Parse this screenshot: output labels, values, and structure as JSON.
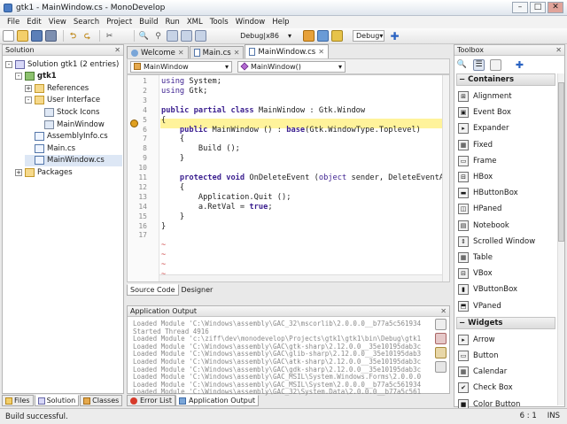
{
  "window": {
    "title": "gtk1 - MainWindow.cs - MonoDevelop"
  },
  "menu": [
    "File",
    "Edit",
    "View",
    "Search",
    "Project",
    "Build",
    "Run",
    "XML",
    "Tools",
    "Window",
    "Help"
  ],
  "toolbar": {
    "config": "Debug|x86",
    "build_target": "Debug"
  },
  "solution_panel": {
    "title": "Solution",
    "tree": [
      {
        "label": "Solution gtk1 (2 entries)",
        "indent": 0,
        "icon": "solution-icon",
        "expander": "-"
      },
      {
        "label": "gtk1",
        "indent": 1,
        "icon": "project-icon",
        "expander": "-",
        "bold": true
      },
      {
        "label": "References",
        "indent": 2,
        "icon": "folder-icon",
        "expander": "+"
      },
      {
        "label": "User Interface",
        "indent": 2,
        "icon": "folder-icon",
        "expander": "-"
      },
      {
        "label": "Stock Icons",
        "indent": 3,
        "icon": "stock-icons-icon",
        "expander": ""
      },
      {
        "label": "MainWindow",
        "indent": 3,
        "icon": "window-icon",
        "expander": ""
      },
      {
        "label": "AssemblyInfo.cs",
        "indent": 2,
        "icon": "cs-file-icon",
        "expander": ""
      },
      {
        "label": "Main.cs",
        "indent": 2,
        "icon": "cs-file-icon",
        "expander": ""
      },
      {
        "label": "MainWindow.cs",
        "indent": 2,
        "icon": "cs-file-icon",
        "expander": "",
        "selected": true
      },
      {
        "label": "Packages",
        "indent": 1,
        "icon": "folder-icon",
        "expander": "+"
      }
    ],
    "tabs": [
      "Files",
      "Solution",
      "Classes"
    ]
  },
  "editor": {
    "tabs": [
      "Welcome",
      "Main.cs",
      "MainWindow.cs"
    ],
    "active_tab": "MainWindow.cs",
    "class_combo": "MainWindow",
    "member_combo": "MainWindow()",
    "line_numbers": [
      "1",
      "2",
      "3",
      "4",
      "5",
      "6",
      "7",
      "8",
      "9",
      "10",
      "11",
      "12",
      "13",
      "14",
      "15",
      "16",
      "17"
    ],
    "view_tabs": [
      "Source Code",
      "Designer"
    ]
  },
  "output_panel": {
    "title": "Application Output",
    "lines": [
      "Loaded Module 'C:\\Windows\\assembly\\GAC_32\\mscorlib\\2.0.0.0__b77a5c561934e089\\mscorlib.dll'",
      "Started Thread 4916",
      "Loaded Module 'c:\\ziff\\dev\\monodevelop\\Projects\\gtk1\\gtk1\\bin\\Debug\\gtk1.exe'",
      "Loaded Module 'C:\\Windows\\assembly\\GAC\\gtk-sharp\\2.12.0.0__35e10195dab3c99f\\gtk-sharp.dll'",
      "Loaded Module 'C:\\Windows\\assembly\\GAC\\glib-sharp\\2.12.0.0__35e10195dab3c99f\\glib-sharp.dll'",
      "Loaded Module 'C:\\Windows\\assembly\\GAC\\atk-sharp\\2.12.0.0__35e10195dab3c99f\\atk-sharp.dll'",
      "Loaded Module 'C:\\Windows\\assembly\\GAC\\gdk-sharp\\2.12.0.0__35e10195dab3c99f\\gdk-sharp.dll'",
      "Loaded Module 'C:\\Windows\\assembly\\GAC_MSIL\\System.Windows.Forms\\2.0.0.0__b77a5c561934e089'",
      "Loaded Module 'C:\\Windows\\assembly\\GAC_MSIL\\System\\2.0.0.0__b77a5c561934e089\\System.dll'",
      "Loaded Module 'C:\\Windows\\assembly\\GAC_32\\System.Data\\2.0.0.0__b77a5c561934e089\\System.Data'"
    ],
    "bottom_tabs": [
      "Error List",
      "Application Output"
    ]
  },
  "toolbox": {
    "title": "Toolbox",
    "sections": [
      {
        "name": "Containers",
        "items": [
          "Alignment",
          "Event Box",
          "Expander",
          "Fixed",
          "Frame",
          "HBox",
          "HButtonBox",
          "HPaned",
          "Notebook",
          "Scrolled Window",
          "Table",
          "VBox",
          "VButtonBox",
          "VPaned"
        ]
      },
      {
        "name": "Widgets",
        "items": [
          "Arrow",
          "Button",
          "Calendar",
          "Check Box",
          "Color Button"
        ]
      }
    ]
  },
  "statusbar": {
    "message": "Build successful.",
    "position": "6 : 1",
    "mode": "INS"
  },
  "colors": {
    "highlight": "#fff39b",
    "keyword": "#3b1f8f",
    "string": "#a30000"
  }
}
